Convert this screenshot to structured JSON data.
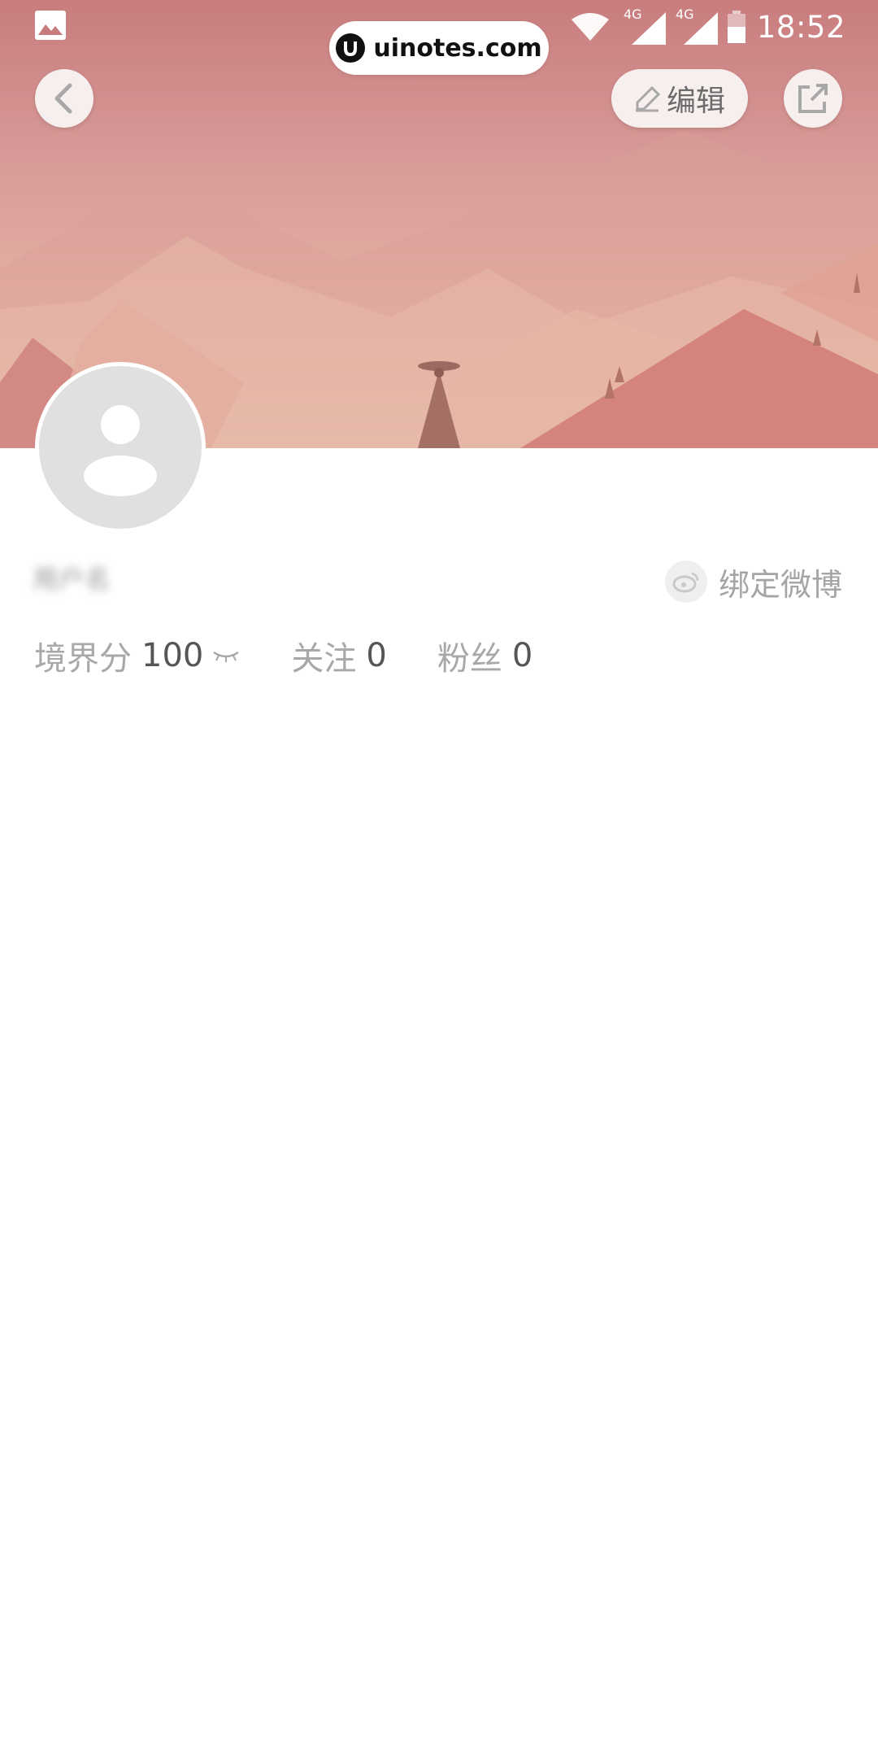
{
  "status_bar": {
    "time": "18:52",
    "network_1": "4G",
    "network_2": "4G"
  },
  "watermark": {
    "text": "uinotes.com"
  },
  "header": {
    "edit_label": "编辑"
  },
  "profile": {
    "username": "用户名",
    "bind_weibo_label": "绑定微博"
  },
  "stats": {
    "realm_label": "境界分",
    "realm_value": "100",
    "following_label": "关注",
    "following_value": "0",
    "fans_label": "粉丝",
    "fans_value": "0"
  },
  "colors": {
    "banner_top": "#c97c7d",
    "banner_bottom": "#f2cfb8",
    "button_bg": "#f6efee",
    "avatar_bg": "#e0e0e0"
  }
}
